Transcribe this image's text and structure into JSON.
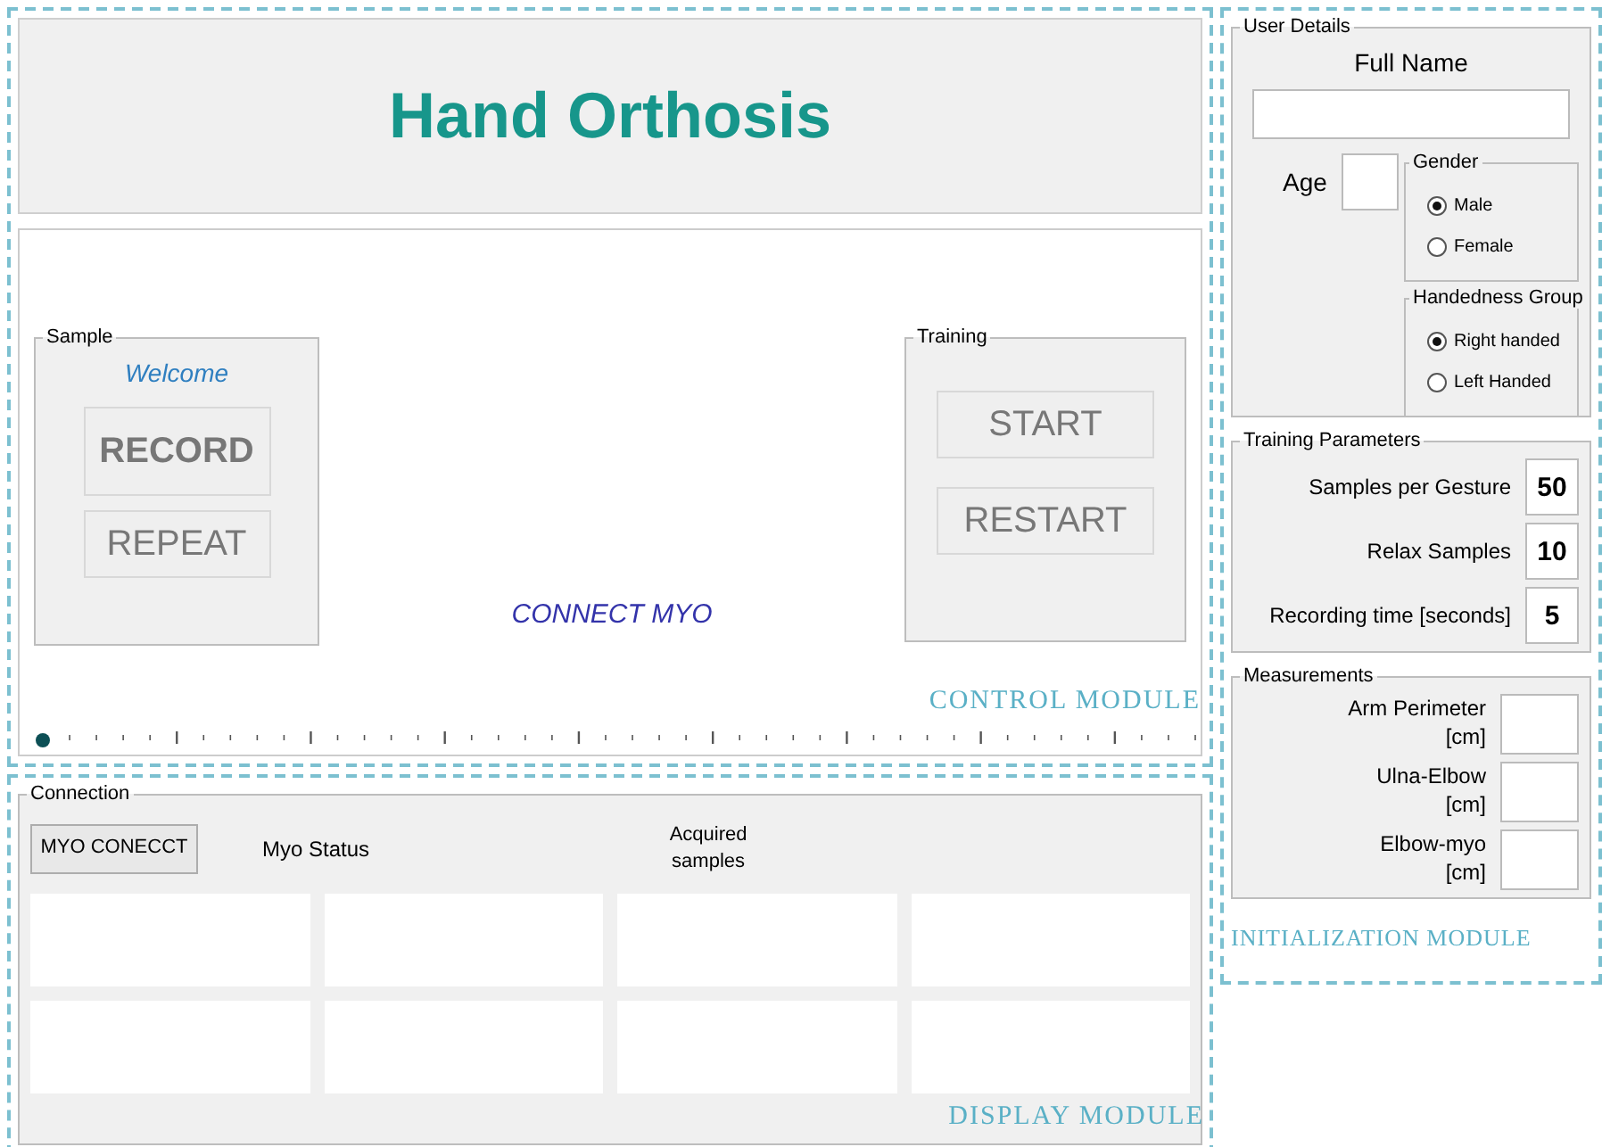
{
  "title": "Hand Orthosis",
  "control_module": {
    "label": "CONTROL MODULE",
    "sample": {
      "title": "Sample",
      "message": "Welcome",
      "buttons": [
        {
          "label": "RECORD",
          "bold": true
        },
        {
          "label": "REPEAT",
          "bold": false
        }
      ]
    },
    "status": "CONNECT MYO",
    "training": {
      "title": "Training",
      "buttons": [
        {
          "label": "START",
          "bold": false
        },
        {
          "label": "RESTART",
          "bold": false
        }
      ]
    },
    "slider": {
      "level": 0
    }
  },
  "display_module": {
    "label": "DISPLAY MODULE",
    "connection": {
      "title": "Connection",
      "button": "MYO CONECCT",
      "status_label": "Myo Status",
      "samples_label": "Acquired samples"
    }
  },
  "initialization_module": {
    "label": "INITIALIZATION MODULE",
    "user_details": {
      "title": "User Details",
      "full_name_label": "Full Name",
      "age_label": "Age",
      "gender": {
        "title": "Gender",
        "options": [
          {
            "label": "Male",
            "selected": true
          },
          {
            "label": "Female",
            "selected": false
          }
        ]
      },
      "handedness": {
        "title": "Handedness Group",
        "options": [
          {
            "label": "Right handed",
            "selected": true
          },
          {
            "label": "Left Handed",
            "selected": false
          }
        ]
      }
    },
    "training_parameters": {
      "title": "Training Parameters",
      "rows": [
        {
          "label": "Samples per Gesture",
          "value": "50"
        },
        {
          "label": "Relax Samples",
          "value": "10"
        },
        {
          "label": "Recording time [seconds]",
          "value": "5"
        }
      ]
    },
    "measurements": {
      "title": "Measurements",
      "rows": [
        {
          "label": "Arm Perimeter [cm]"
        },
        {
          "label": "Ulna-Elbow [cm]"
        },
        {
          "label": "Elbow-myo [cm]"
        }
      ]
    }
  }
}
